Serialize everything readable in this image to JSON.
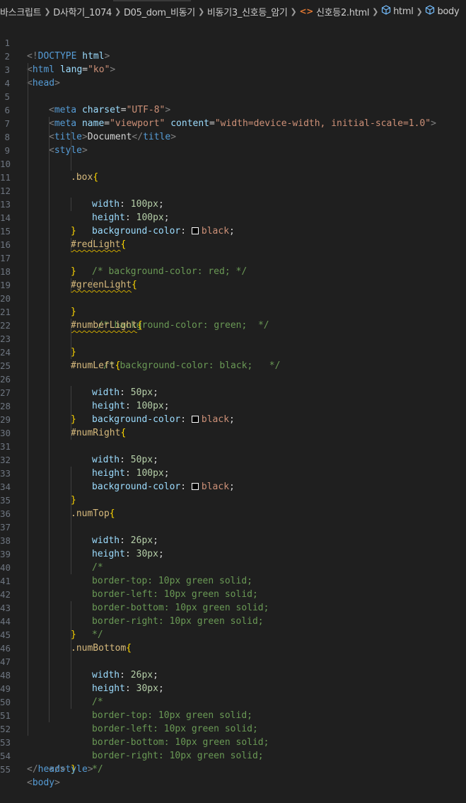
{
  "breadcrumb": {
    "items": [
      "바스크립트",
      "D사학기_1074",
      "D05_dom_비동기",
      "비동기3_신호등_암기",
      "신호등2.html",
      "html",
      "body"
    ],
    "file_icon": "html-file-icon",
    "element_icon": "cube-icon"
  },
  "colors": {
    "background": "#1f1f1f",
    "tag": "#569cd6",
    "attribute": "#9cdcfe",
    "string": "#ce9178",
    "selector": "#d7ba7d",
    "number": "#b5cea8",
    "comment": "#6a9955"
  },
  "code_lines": [
    {
      "n": "1"
    },
    {
      "n": "2"
    },
    {
      "n": "3"
    },
    {
      "n": "4"
    },
    {
      "n": "5"
    },
    {
      "n": "6"
    },
    {
      "n": "7"
    },
    {
      "n": "8"
    },
    {
      "n": "9"
    },
    {
      "n": "10"
    },
    {
      "n": "11"
    },
    {
      "n": "12"
    },
    {
      "n": "13"
    },
    {
      "n": "14"
    },
    {
      "n": "15"
    },
    {
      "n": "16"
    },
    {
      "n": "17"
    },
    {
      "n": "18"
    },
    {
      "n": "19"
    },
    {
      "n": "20"
    },
    {
      "n": "21"
    },
    {
      "n": "22"
    },
    {
      "n": "23"
    },
    {
      "n": "24"
    },
    {
      "n": "25"
    },
    {
      "n": "26"
    },
    {
      "n": "27"
    },
    {
      "n": "28"
    },
    {
      "n": "29"
    },
    {
      "n": "30"
    },
    {
      "n": "31"
    },
    {
      "n": "32"
    },
    {
      "n": "33"
    },
    {
      "n": "34"
    },
    {
      "n": "35"
    },
    {
      "n": "36"
    },
    {
      "n": "37"
    },
    {
      "n": "38"
    },
    {
      "n": "39"
    },
    {
      "n": "40"
    },
    {
      "n": "41"
    },
    {
      "n": "42"
    },
    {
      "n": "43"
    },
    {
      "n": "44"
    },
    {
      "n": "45"
    },
    {
      "n": "46"
    },
    {
      "n": "47"
    },
    {
      "n": "48"
    },
    {
      "n": "49"
    },
    {
      "n": "50"
    },
    {
      "n": "51"
    },
    {
      "n": "52"
    },
    {
      "n": "53"
    },
    {
      "n": "54"
    },
    {
      "n": "55"
    }
  ],
  "code": {
    "l1": [
      "<!",
      "DOCTYPE",
      " ",
      "html",
      ">"
    ],
    "l2": [
      "<",
      "html",
      " ",
      "lang",
      "=",
      "\"ko\"",
      ">"
    ],
    "l3": [
      "<",
      "head",
      ">"
    ],
    "l4": [
      "<",
      "meta",
      " ",
      "charset",
      "=",
      "\"UTF-8\"",
      ">"
    ],
    "l5": [
      "<",
      "meta",
      " ",
      "name",
      "=",
      "\"viewport\"",
      " ",
      "content",
      "=",
      "\"width=device-width, initial-scale=1.0\"",
      ">"
    ],
    "l6": [
      "<",
      "title",
      ">",
      "Document",
      "</",
      "title",
      ">"
    ],
    "l7": [
      "<",
      "style",
      ">"
    ],
    "l8": [
      ".box",
      "{"
    ],
    "l9": [
      "width",
      ": ",
      "100px",
      ";"
    ],
    "l10": [
      "height",
      ": ",
      "100px",
      ";"
    ],
    "l11": [
      "background-color",
      ": ",
      "black",
      ";"
    ],
    "l12": [
      "}"
    ],
    "l13": [
      "#redLight",
      "{"
    ],
    "l14": [
      "/* background-color: red; */"
    ],
    "l15": [
      "}"
    ],
    "l16": [
      "#greenLight",
      "{"
    ],
    "l17": [
      "/* background-color: green;  */"
    ],
    "l18": [
      "}"
    ],
    "l19": [
      "#numberLight",
      "{"
    ],
    "l20": [
      "/* background-color: black;   */"
    ],
    "l21": [
      "}"
    ],
    "l22": [
      "#numLeft",
      "{"
    ],
    "l23": [
      "width",
      ": ",
      "50px",
      ";"
    ],
    "l24": [
      "height",
      ": ",
      "100px",
      ";"
    ],
    "l25": [
      "background-color",
      ": ",
      "black",
      ";"
    ],
    "l26": [
      "}"
    ],
    "l27": [
      "#numRight",
      "{"
    ],
    "l28": [
      "width",
      ": ",
      "50px",
      ";"
    ],
    "l29": [
      "height",
      ": ",
      "100px",
      ";"
    ],
    "l30": [
      "background-color",
      ": ",
      "black",
      ";"
    ],
    "l32": [
      "}"
    ],
    "l33": [
      ".numTop",
      "{"
    ],
    "l34": [
      "width",
      ": ",
      "26px",
      ";"
    ],
    "l35": [
      "height",
      ": ",
      "30px",
      ";"
    ],
    "l36": [
      "/*"
    ],
    "l37": [
      "border-top: 10px green solid;"
    ],
    "l38": [
      "border-left: 10px green solid;"
    ],
    "l39": [
      "border-bottom: 10px green solid;"
    ],
    "l40": [
      "border-right: 10px green solid;"
    ],
    "l41": [
      "*/"
    ],
    "l42": [
      "}"
    ],
    "l43": [
      ".numBottom",
      "{"
    ],
    "l44": [
      "width",
      ": ",
      "26px",
      ";"
    ],
    "l45": [
      "height",
      ": ",
      "30px",
      ";"
    ],
    "l46": [
      "/*"
    ],
    "l47": [
      "border-top: 10px green solid;"
    ],
    "l48": [
      "border-left: 10px green solid;"
    ],
    "l49": [
      "border-bottom: 10px green solid;"
    ],
    "l50": [
      "border-right: 10px green solid;"
    ],
    "l51": [
      "*/"
    ],
    "l52": [
      "}"
    ],
    "l53": [
      "</",
      "style",
      ">"
    ],
    "l54": [
      "</",
      "head",
      ">"
    ],
    "l55": [
      "<",
      "body",
      ">"
    ]
  }
}
